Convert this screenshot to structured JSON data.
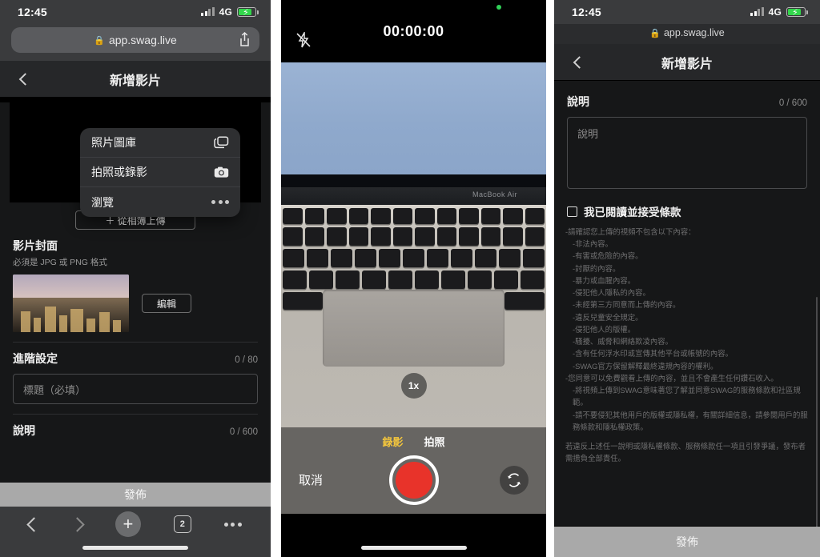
{
  "panel1": {
    "status": {
      "time": "12:45",
      "network": "4G"
    },
    "url": "app.swag.live",
    "nav": {
      "title": "新增影片",
      "back_icon": "chevron-left-icon"
    },
    "video_placeholder_icon": "no-video-icon",
    "upload_button": "＋ 從相簿上傳",
    "context_menu": [
      {
        "label": "照片圖庫",
        "icon": "photo-library-icon"
      },
      {
        "label": "拍照或錄影",
        "icon": "camera-icon"
      },
      {
        "label": "瀏覽",
        "icon": "ellipsis-icon"
      }
    ],
    "cover": {
      "title": "影片封面",
      "subtitle": "必須是 JPG 或 PNG 格式",
      "edit_button": "編輯"
    },
    "advanced": {
      "title": "進階設定",
      "count": "0 / 80",
      "title_placeholder": "標題（必填）"
    },
    "description": {
      "title": "說明",
      "count": "0 / 600"
    },
    "publish_button": "發佈",
    "browser_toolbar": {
      "tab_count": "2",
      "plus_label": "+"
    }
  },
  "panel2": {
    "timer": "00:00:00",
    "flash_icon": "flash-off-icon",
    "zoom_level": "1x",
    "modes": [
      {
        "label": "錄影",
        "active": true
      },
      {
        "label": "拍照",
        "active": false
      }
    ],
    "cancel_button": "取消",
    "shutter": "record-button",
    "flip_icon": "camera-flip-icon",
    "device_label": "MacBook Air",
    "colors": {
      "record": "#e8332a",
      "active_mode": "#f2c53d"
    }
  },
  "panel3": {
    "status": {
      "time": "12:45",
      "network": "4G"
    },
    "url": "app.swag.live",
    "nav": {
      "title": "新增影片",
      "back_icon": "chevron-left-icon"
    },
    "description": {
      "title": "說明",
      "count": "0 / 600",
      "placeholder": "說明"
    },
    "terms_checkbox_label": "我已閱讀並接受條款",
    "terms": [
      "-請確認您上傳的視頻不包含以下內容：",
      "-非法內容。",
      "-有害或危險的內容。",
      "-討厭的內容。",
      "-暴力或血腥內容。",
      "-侵犯他人隱私的內容。",
      "-未經第三方同意而上傳的內容。",
      "-違反兒童安全規定。",
      "-侵犯他人的版權。",
      "-騷擾、威脅和網絡欺凌內容。",
      "-含有任何浮水印或宣傳其他平台或帳號的內容。",
      "-SWAG官方保留解釋最終違規內容的權利。",
      "-您同意可以免費觀看上傳的內容，並且不會產生任何鑽石收入。",
      "-將視頻上傳到SWAG意味著您了解並同意SWAG的服務條款和社區規範。",
      "-請不要侵犯其他用戶的版權或隱私權，有關詳細信息，請參閱用戶的服務條款和隱私權政策。",
      "若違反上述任一說明或隱私權條款、服務條款任一項且引發爭議，發布者需擔負全部責任。"
    ],
    "publish_button": "發佈"
  }
}
